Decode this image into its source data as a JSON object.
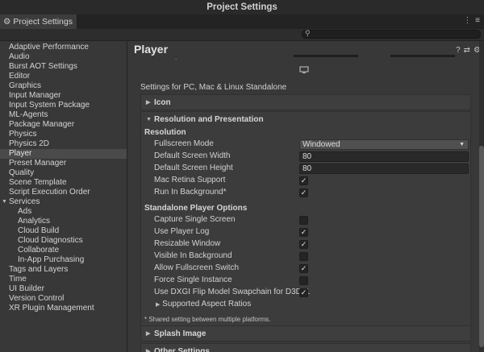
{
  "window_title": "Project Settings",
  "tab": {
    "label": "Project Settings",
    "menu_icon": "⋮ ≡"
  },
  "search": {
    "placeholder": ""
  },
  "sidebar": {
    "items": [
      {
        "label": "Adaptive Performance"
      },
      {
        "label": "Audio"
      },
      {
        "label": "Burst AOT Settings"
      },
      {
        "label": "Editor"
      },
      {
        "label": "Graphics"
      },
      {
        "label": "Input Manager"
      },
      {
        "label": "Input System Package"
      },
      {
        "label": "ML-Agents"
      },
      {
        "label": "Package Manager"
      },
      {
        "label": "Physics"
      },
      {
        "label": "Physics 2D"
      },
      {
        "label": "Player",
        "selected": true
      },
      {
        "label": "Preset Manager"
      },
      {
        "label": "Quality"
      },
      {
        "label": "Scene Template"
      },
      {
        "label": "Script Execution Order"
      },
      {
        "label": "Services",
        "expanded": true
      },
      {
        "label": "Ads",
        "child": true
      },
      {
        "label": "Analytics",
        "child": true
      },
      {
        "label": "Cloud Build",
        "child": true
      },
      {
        "label": "Cloud Diagnostics",
        "child": true
      },
      {
        "label": "Collaborate",
        "child": true
      },
      {
        "label": "In-App Purchasing",
        "child": true
      },
      {
        "label": "Tags and Layers"
      },
      {
        "label": "Time"
      },
      {
        "label": "UI Builder"
      },
      {
        "label": "Version Control"
      },
      {
        "label": "XR Plugin Management"
      }
    ]
  },
  "main": {
    "title": "Player",
    "platform_text": "Settings for PC, Mac & Linux Standalone",
    "icon_section": "Icon",
    "rp_section": "Resolution and Presentation",
    "resolution_header": "Resolution",
    "fullscreen_label": "Fullscreen Mode",
    "fullscreen_value": "Windowed",
    "width_label": "Default Screen Width",
    "width_value": "80",
    "height_label": "Default Screen Height",
    "height_value": "80",
    "retina_label": "Mac Retina Support",
    "background_label": "Run In Background*",
    "standalone_header": "Standalone Player Options",
    "capture_label": "Capture Single Screen",
    "log_label": "Use Player Log",
    "resizable_label": "Resizable Window",
    "visible_bg_label": "Visible In Background",
    "allow_fs_label": "Allow Fullscreen Switch",
    "force_single_label": "Force Single Instance",
    "dxgi_label": "Use DXGI Flip Model Swapchain for D3D11",
    "aspect_label": "Supported Aspect Ratios",
    "note": "* Shared setting between multiple platforms.",
    "splash_section": "Splash Image",
    "other_section": "Other Settings"
  },
  "checkboxes": {
    "retina": true,
    "run_background": true,
    "capture": false,
    "player_log": true,
    "resizable": true,
    "visible_bg": false,
    "allow_fullscreen_switch": true,
    "force_single": false,
    "dxgi": true
  },
  "icons": {
    "help": "?",
    "preset": "⇄",
    "settings": "⚙"
  }
}
